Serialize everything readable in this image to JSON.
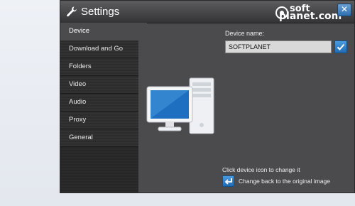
{
  "window": {
    "title": "Settings",
    "close_label": "✕"
  },
  "watermark": {
    "line1": "soft",
    "line2": "planet.com"
  },
  "sidebar": {
    "items": [
      {
        "label": "Device",
        "active": true
      },
      {
        "label": "Download and Go"
      },
      {
        "label": "Folders"
      },
      {
        "label": "Video"
      },
      {
        "label": "Audio"
      },
      {
        "label": "Proxy"
      },
      {
        "label": "General"
      }
    ]
  },
  "device": {
    "name_label": "Device name:",
    "name_value": "SOFTPLANET",
    "confirm_icon": "checkmark-icon",
    "hint": "Click device icon to change it",
    "reset_label": "Change back to the original image",
    "reset_icon": "return-arrow-icon"
  },
  "colors": {
    "accent": "#2f7fcf",
    "window_bg": "#4b4b4d",
    "sidebar_bg": "#2b2b2b"
  }
}
